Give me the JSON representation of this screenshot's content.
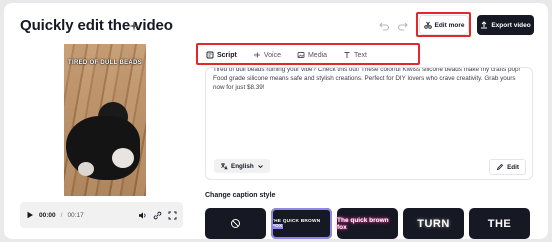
{
  "header": {
    "title": "Quickly edit the video",
    "edit_more_label": "Edit more",
    "export_label": "Export video"
  },
  "player": {
    "video_caption": "TIRED OF DULL BEADS",
    "current_time": "00:00",
    "separator": "/",
    "duration": "00:17"
  },
  "tabs": [
    {
      "label": "Script",
      "icon": "script-icon"
    },
    {
      "label": "Voice",
      "icon": "voice-icon"
    },
    {
      "label": "Media",
      "icon": "media-icon"
    },
    {
      "label": "Text",
      "icon": "text-icon"
    }
  ],
  "script": {
    "text": "Tired of dull beads ruining your vibe? Check this out! These colorful Kiwiss silicone beads make my crafts pop! Food grade silicone means safe and stylish creations. Perfect for DIY lovers who crave creativity. Grab yours now for just $8.39!",
    "language": "English",
    "edit_label": "Edit"
  },
  "caption_style": {
    "title": "Change caption style",
    "styles": [
      {
        "label": "",
        "icon": "no-style-icon"
      },
      {
        "label_prefix": "THE QUICK BROWN ",
        "label_highlight": "FOX"
      },
      {
        "label": "The quick brown fox"
      },
      {
        "label": "TURN"
      },
      {
        "label": "THE"
      }
    ]
  },
  "colors": {
    "highlight_box": "#e0282d",
    "export_bg": "#161823",
    "selected_style": "#8f88e6"
  }
}
